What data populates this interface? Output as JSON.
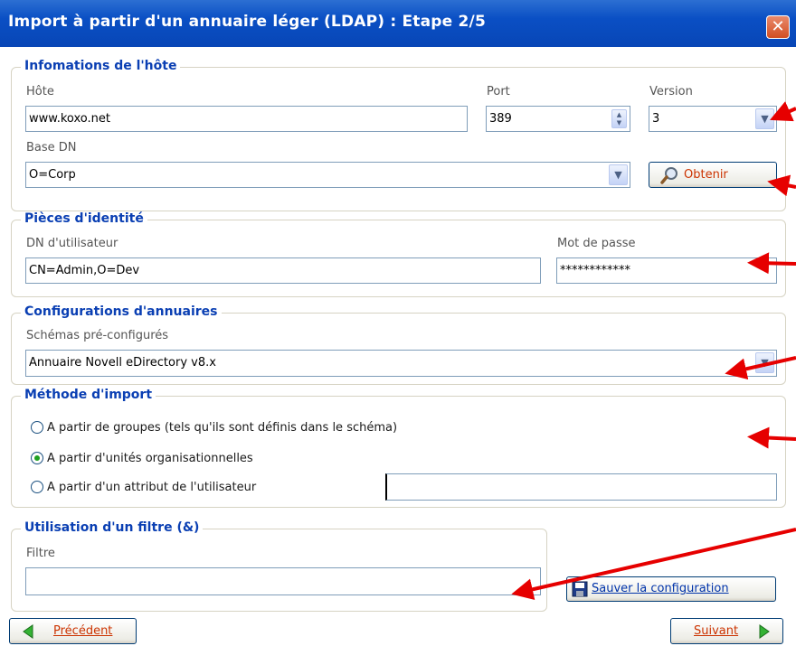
{
  "window": {
    "title": "Import à partir d'un annuaire léger (LDAP) : Etape 2/5",
    "close_glyph": "✕"
  },
  "host": {
    "legend": "Infomations de l'hôte",
    "host_label": "Hôte",
    "host_value": "www.koxo.net",
    "port_label": "Port",
    "port_value": "389",
    "version_label": "Version",
    "version_value": "3",
    "basedn_label": "Base DN",
    "basedn_value": "O=Corp",
    "obtain_button": "Obtenir"
  },
  "credentials": {
    "legend": "Pièces d'identité",
    "user_dn_label": "DN d'utilisateur",
    "user_dn_value": "CN=Admin,O=Dev",
    "password_label": "Mot de passe",
    "password_value": "************"
  },
  "directory": {
    "legend": "Configurations d'annuaires",
    "schemas_label": "Schémas pré-configurés",
    "schema_value": "Annuaire Novell eDirectory v8.x"
  },
  "import_method": {
    "legend": "Méthode d'import",
    "options": [
      {
        "label": "A partir de groupes  (tels qu'ils sont définis dans le schéma)",
        "selected": false
      },
      {
        "label": "A partir d'unités organisationnelles",
        "selected": true
      },
      {
        "label": "A partir d'un attribut de l'utilisateur",
        "selected": false
      }
    ],
    "attribute_value": ""
  },
  "filter": {
    "legend": "Utilisation d'un filtre (&)",
    "filter_label": "Filtre",
    "filter_value": ""
  },
  "buttons": {
    "save": "Sauver la configuration",
    "previous": "Précédent",
    "next": "Suivant"
  },
  "colors": {
    "annotation_arrow": "#e60000",
    "legend_text": "#0a3fb3",
    "titlebar": "#0a4fc4"
  }
}
